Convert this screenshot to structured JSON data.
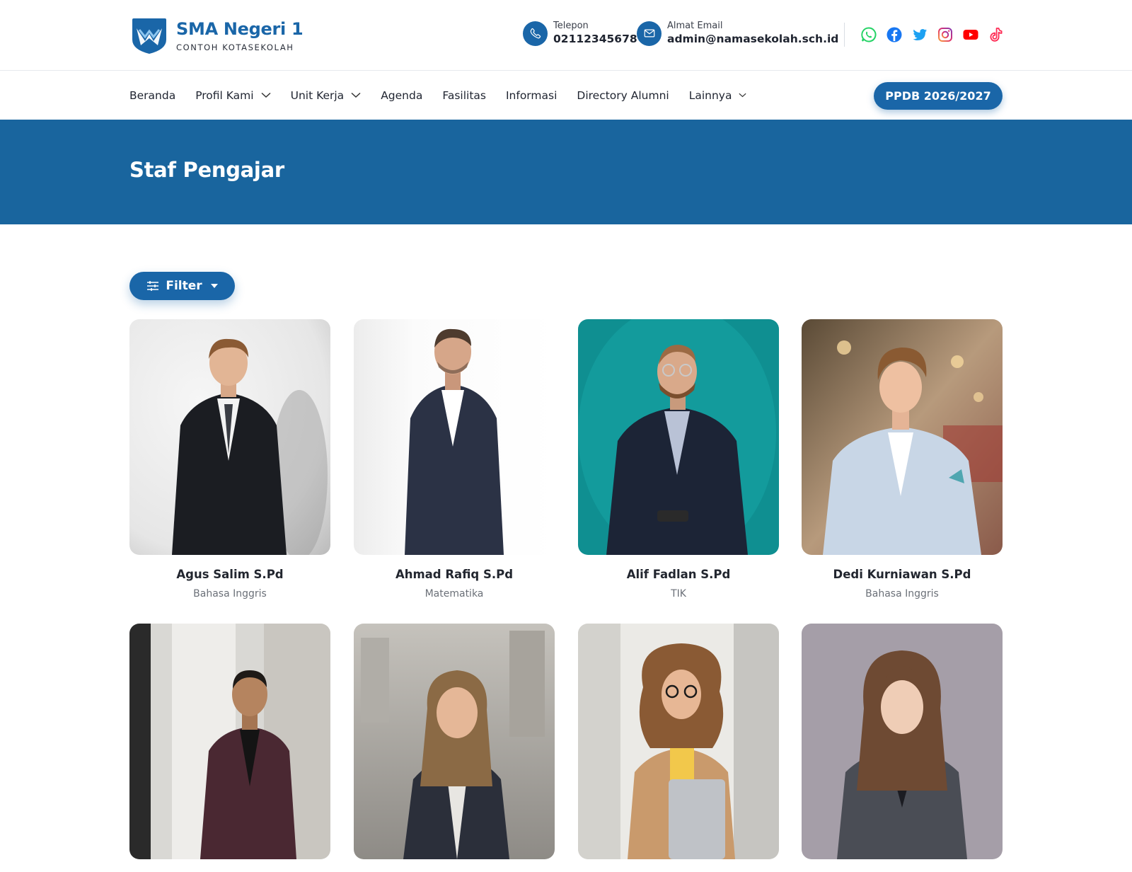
{
  "brand": {
    "title": "SMA Negeri 1",
    "subtitle": "CONTOH KOTASEKOLAH",
    "accent_color": "#1a66a8"
  },
  "contact": {
    "phone_label": "Telepon",
    "phone_value": "02112345678",
    "email_label": "Almat Email",
    "email_value": "admin@namasekolah.sch.id"
  },
  "socials": [
    "whatsapp-icon",
    "facebook-icon",
    "twitter-icon",
    "instagram-icon",
    "youtube-icon",
    "tiktok-icon"
  ],
  "nav": {
    "items": [
      {
        "label": "Beranda"
      },
      {
        "label": "Profil Kami"
      },
      {
        "label": "Unit Kerja"
      },
      {
        "label": "Agenda"
      },
      {
        "label": "Fasilitas"
      },
      {
        "label": "Informasi"
      },
      {
        "label": "Directory Alumni"
      },
      {
        "label": "Lainnya"
      }
    ],
    "cta_label": "PPDB 2026/2027"
  },
  "hero": {
    "title": "Staf Pengajar",
    "background": "#19659e"
  },
  "filter": {
    "label": "Filter"
  },
  "teachers": [
    {
      "name": "Agus Salim S.Pd",
      "subject": "Bahasa Inggris"
    },
    {
      "name": "Ahmad Rafiq S.Pd",
      "subject": "Matematika"
    },
    {
      "name": "Alif Fadlan S.Pd",
      "subject": "TIK"
    },
    {
      "name": "Dedi Kurniawan S.Pd",
      "subject": "Bahasa Inggris"
    },
    {
      "name": "",
      "subject": ""
    },
    {
      "name": "",
      "subject": ""
    },
    {
      "name": "",
      "subject": ""
    },
    {
      "name": "",
      "subject": ""
    }
  ]
}
